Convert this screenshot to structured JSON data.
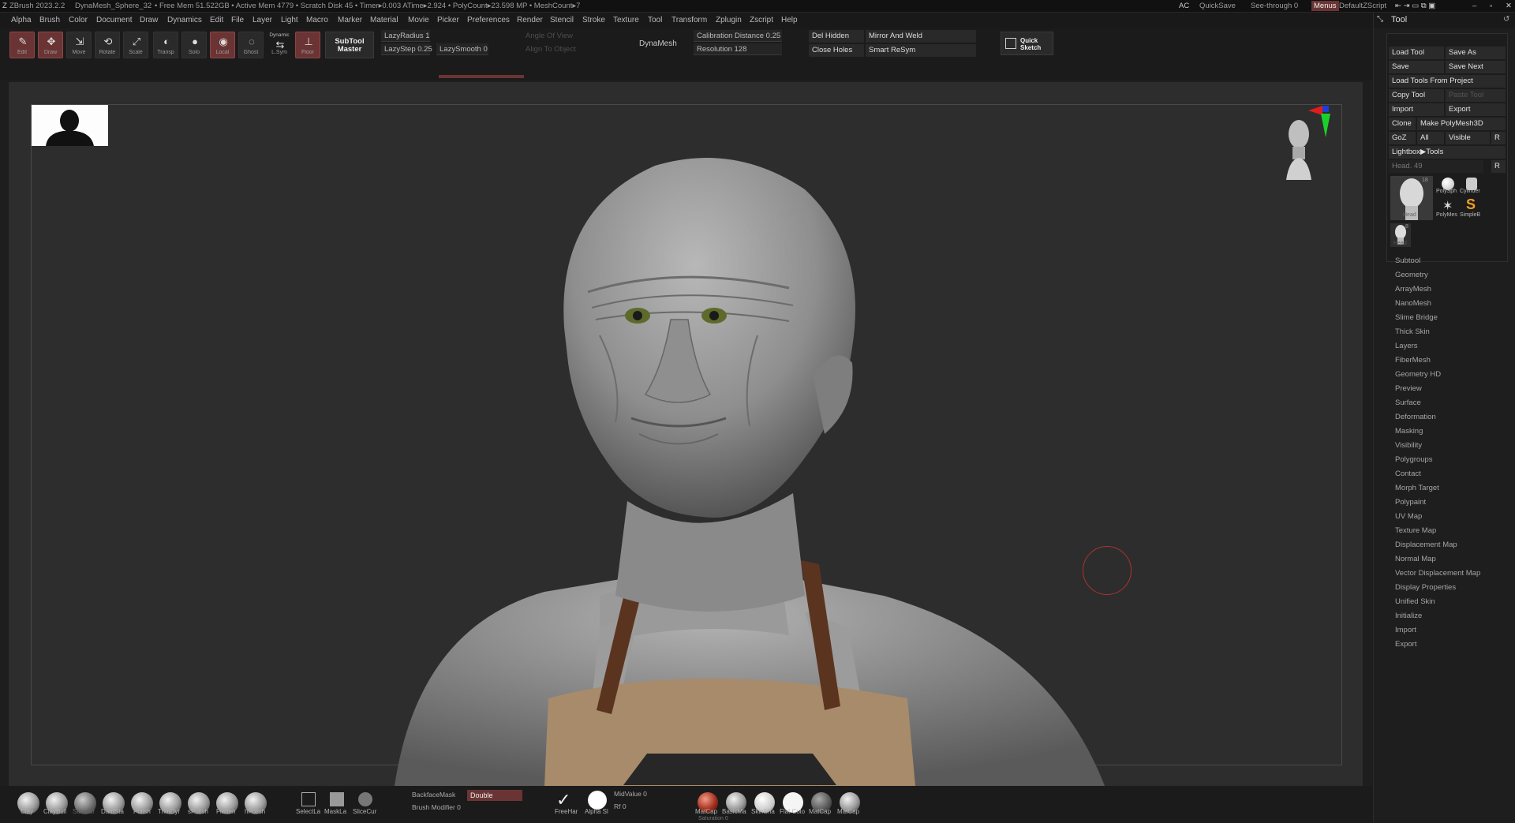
{
  "titlebar": {
    "app": "ZBrush 2023.2.2",
    "doc": "DynaMesh_Sphere_32",
    "stats": "• Free Mem 51.522GB • Active Mem 4779 • Scratch Disk 45 • Timer▸0.003 ATime▸2.924 • PolyCount▸23.598 MP • MeshCount▸7",
    "ac": "AC",
    "quicksave": "QuickSave",
    "seethrough": "See-through 0",
    "menus": "Menus",
    "script": "DefaultZScript"
  },
  "menu": [
    "Alpha",
    "Brush",
    "Color",
    "Document",
    "Draw",
    "Dynamics",
    "Edit",
    "File",
    "Layer",
    "Light",
    "Macro",
    "Marker",
    "Material",
    "Movie",
    "Picker",
    "Preferences",
    "Render",
    "Stencil",
    "Stroke",
    "Texture",
    "Tool",
    "Transform",
    "Zplugin",
    "Zscript",
    "Help"
  ],
  "toolbar": {
    "buttons": [
      "Edit",
      "Draw",
      "Move",
      "Rotate",
      "Scale",
      "Transp",
      "Solo",
      "Local",
      "Ghost",
      "L.Sym",
      "Floor"
    ],
    "dynamic_label": "Dynamic",
    "subtool_master": "SubTool Master",
    "lazy_radius": "LazyRadius 1",
    "lazy_step": "LazyStep 0.25",
    "lazy_smooth": "LazySmooth 0",
    "angle_of_view": "Angle Of View",
    "align_to_object": "Align To Object",
    "dynamesh": "DynaMesh",
    "calibration": "Calibration Distance 0.25",
    "resolution": "Resolution 128",
    "del_hidden": "Del Hidden",
    "close_holes": "Close Holes",
    "mirror_weld": "Mirror And Weld",
    "smart_resym": "Smart ReSym",
    "quick_sketch": "Quick Sketch"
  },
  "tool_panel": {
    "title": "Tool",
    "load_tool": "Load Tool",
    "save_as": "Save As",
    "save": "Save",
    "save_next": "Save Next",
    "load_from_project": "Load Tools From Project",
    "copy_tool": "Copy Tool",
    "paste_tool": "Paste Tool",
    "import": "Import",
    "export": "Export",
    "clone": "Clone",
    "make_polymesh": "Make PolyMesh3D",
    "goz": "GoZ",
    "all": "All",
    "visible": "Visible",
    "r": "R",
    "lightbox": "Lightbox▶Tools",
    "head_slider": "Head. 49",
    "thumbs": [
      {
        "name": "Head",
        "count": "18"
      },
      {
        "name": "PolySph"
      },
      {
        "name": "Cylinder"
      },
      {
        "name": "PolyMes"
      },
      {
        "name": "SimpleB"
      },
      {
        "name": "Head",
        "count": "8"
      }
    ],
    "sections": [
      "Subtool",
      "Geometry",
      "ArrayMesh",
      "NanoMesh",
      "Slime Bridge",
      "Thick Skin",
      "Layers",
      "FiberMesh",
      "Geometry HD",
      "Preview",
      "Surface",
      "Deformation",
      "Masking",
      "Visibility",
      "Polygroups",
      "Contact",
      "Morph Target",
      "Polypaint",
      "UV Map",
      "Texture Map",
      "Displacement Map",
      "Normal Map",
      "Vector Displacement Map",
      "Display Properties",
      "Unified Skin",
      "Initialize",
      "Import",
      "Export"
    ]
  },
  "bottom": {
    "brushes": [
      "Clay",
      "ClayBuil",
      "Standar",
      "DamSta",
      "Polish",
      "TrimDyr",
      "sPolish",
      "Flatten",
      "hPolish"
    ],
    "selectors": [
      "SelectLa",
      "MaskLa",
      "SliceCur"
    ],
    "backface_mask": "BackfaceMask",
    "double": "Double",
    "brush_modifier": "Brush Modifier 0",
    "stroke": "FreeHar",
    "alpha": "Alpha Sl",
    "midvalue": "MidValue 0",
    "rf": "Rf 0",
    "materials": [
      "MatCap",
      "BasicMa",
      "SkinSha",
      "Flat Colo",
      "MatCap",
      "MatCap"
    ],
    "saturation": "Saturation 0"
  },
  "colors": {
    "accent": "#6b3434",
    "panel": "#1f1e1e",
    "canvas": "#2d2d2d"
  }
}
